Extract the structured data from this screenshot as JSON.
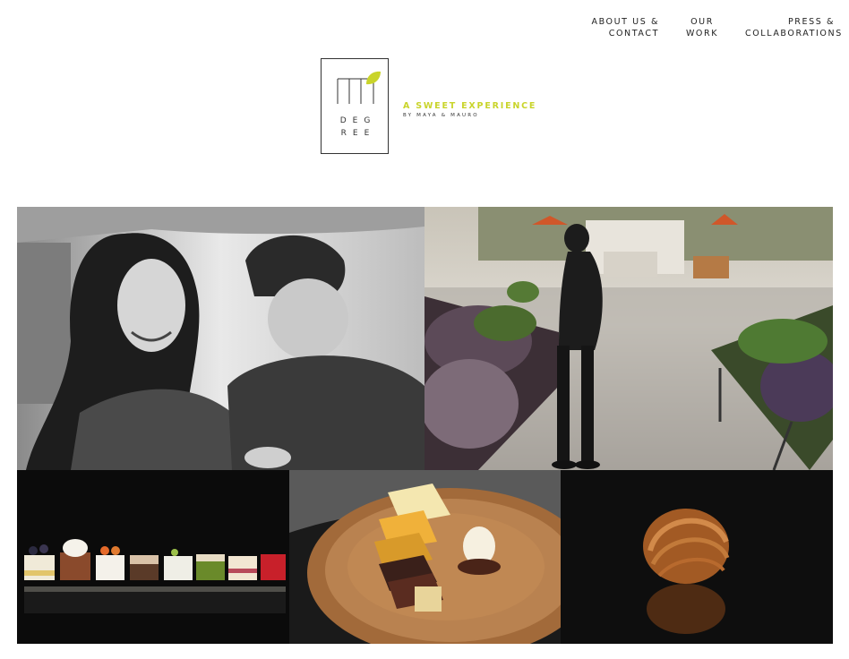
{
  "nav": {
    "about": [
      "ABOUT US &",
      "CONTACT"
    ],
    "work": [
      "OUR",
      "WORK"
    ],
    "press": [
      "PRESS &",
      "COLLABORATIONS"
    ]
  },
  "logo": {
    "line1": "DEG",
    "line2": "REE",
    "accent_color": "#c9d42a"
  },
  "tagline": "A SWEET EXPERIENCE",
  "byline": "BY MAYA & MAURO",
  "gallery": [
    {
      "id": "couple",
      "icon": "photo-couple"
    },
    {
      "id": "market",
      "icon": "photo-market"
    },
    {
      "id": "desserts",
      "icon": "photo-desserts"
    },
    {
      "id": "plate",
      "icon": "photo-chocolate-plate"
    },
    {
      "id": "croissant",
      "icon": "photo-croissant"
    }
  ]
}
